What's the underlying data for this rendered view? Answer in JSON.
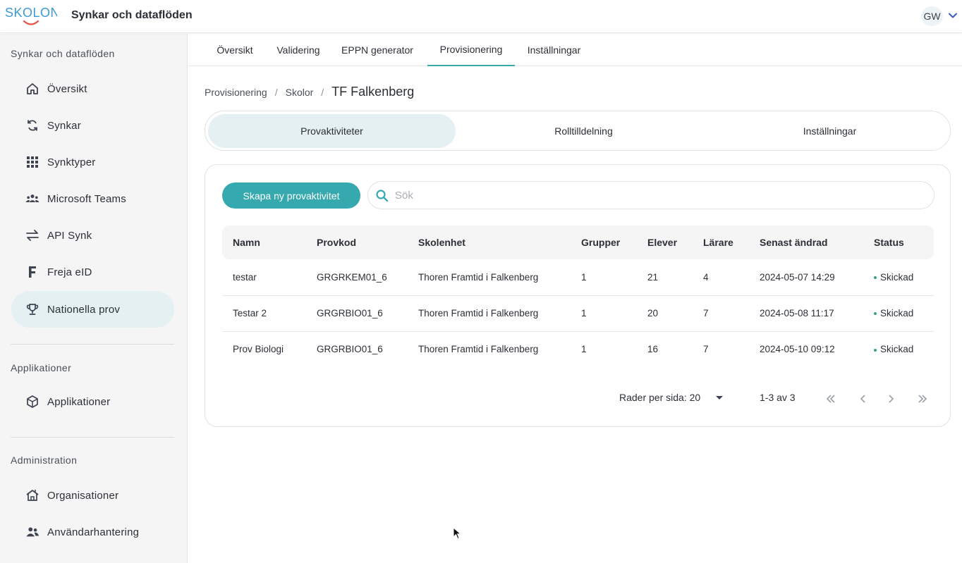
{
  "app": {
    "logo_text": "SKOLON",
    "title": "Synkar och dataflöden",
    "user_initials": "GW"
  },
  "sidebar": {
    "sections": [
      {
        "title": "Synkar och dataflöden"
      },
      {
        "title": "Applikationer"
      },
      {
        "title": "Administration"
      }
    ],
    "items": [
      {
        "label": "Översikt",
        "icon": "home-icon"
      },
      {
        "label": "Synkar",
        "icon": "sync-icon"
      },
      {
        "label": "Synktyper",
        "icon": "grid-icon"
      },
      {
        "label": "Microsoft Teams",
        "icon": "groups-icon"
      },
      {
        "label": "API Synk",
        "icon": "swap-arrows-icon"
      },
      {
        "label": "Freja eID",
        "icon": "freja-f-icon"
      },
      {
        "label": "Nationella prov",
        "icon": "trophy-icon",
        "active": true
      },
      {
        "label": "Applikationer",
        "icon": "hexagon-box-icon"
      },
      {
        "label": "Organisationer",
        "icon": "school-building-icon"
      },
      {
        "label": "Användarhantering",
        "icon": "people-icon"
      }
    ]
  },
  "tabs": [
    {
      "label": "Översikt"
    },
    {
      "label": "Validering"
    },
    {
      "label": "EPPN generator"
    },
    {
      "label": "Provisionering",
      "active": true
    },
    {
      "label": "Inställningar"
    }
  ],
  "breadcrumb": {
    "items": [
      "Provisionering",
      "Skolor"
    ],
    "separator": "/",
    "current": "TF Falkenberg"
  },
  "segments": [
    {
      "label": "Provaktiviteter",
      "active": true
    },
    {
      "label": "Rolltilldelning"
    },
    {
      "label": "Inställningar"
    }
  ],
  "toolbar": {
    "create_label": "Skapa ny provaktivitet",
    "search_placeholder": "Sök",
    "search_value": ""
  },
  "table": {
    "columns": [
      "Namn",
      "Provkod",
      "Skolenhet",
      "Grupper",
      "Elever",
      "Lärare",
      "Senast ändrad",
      "Status"
    ],
    "rows": [
      [
        "testar",
        "GRGRKEM01_6",
        "Thoren Framtid i Falkenberg",
        "1",
        "21",
        "4",
        "2024-05-07 14:29",
        "Skickad"
      ],
      [
        "Testar 2",
        "GRGRBIO01_6",
        "Thoren Framtid i Falkenberg",
        "1",
        "20",
        "7",
        "2024-05-08 11:17",
        "Skickad"
      ],
      [
        "Prov Biologi",
        "GRGRBIO01_6",
        "Thoren Framtid i Falkenberg",
        "1",
        "16",
        "7",
        "2024-05-10 09:12",
        "Skickad"
      ]
    ]
  },
  "pagination": {
    "rows_per_page_label": "Rader per sida: 20",
    "range_label": "1-3 av 3"
  },
  "colors": {
    "accent": "#36a9ae",
    "active_bg": "#e4f0f1",
    "status_sent": "#3aa572",
    "logo_blue": "#3b9ad6",
    "logo_red": "#e2574c"
  }
}
